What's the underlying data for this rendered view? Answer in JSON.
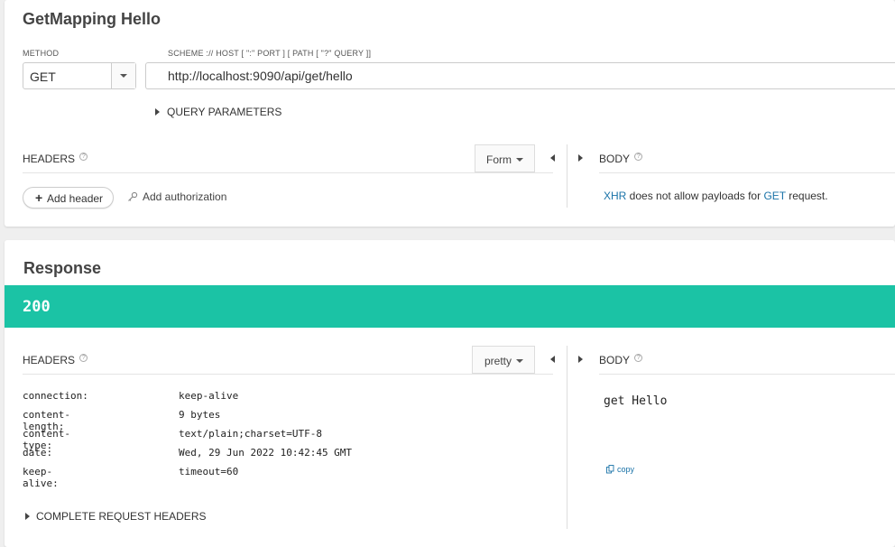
{
  "request": {
    "title": "GetMapping Hello",
    "method_label": "METHOD",
    "method_value": "GET",
    "url_label": "SCHEME :// HOST [ \":\" PORT ] [ PATH [ \"?\" QUERY ]]",
    "url_value": "http://localhost:9090/api/get/hello",
    "query_params_label": "QUERY PARAMETERS",
    "headers_label": "HEADERS",
    "form_button": "Form",
    "body_label": "BODY",
    "add_header": "Add header",
    "add_authorization": "Add authorization",
    "body_note_link1": "XHR",
    "body_note_middle": " does not allow payloads for ",
    "body_note_link2": "GET",
    "body_note_end": " request."
  },
  "response": {
    "title": "Response",
    "status_code": "200",
    "headers_label": "HEADERS",
    "pretty_button": "pretty",
    "body_label": "BODY",
    "headers": [
      {
        "name": "connection:",
        "value": "keep-alive"
      },
      {
        "name": "content-length:",
        "value": "9 bytes"
      },
      {
        "name": "content-type:",
        "value": "text/plain;charset=UTF-8"
      },
      {
        "name": "date:",
        "value": "Wed, 29 Jun 2022 10:42:45 GMT"
      },
      {
        "name": "keep-alive:",
        "value": "timeout=60"
      }
    ],
    "complete_request_headers": "COMPLETE REQUEST HEADERS",
    "body_text": "get Hello",
    "copy_label": "copy"
  },
  "colors": {
    "status_ok": "#1bc3a5",
    "link": "#1a73a8"
  },
  "icons": {
    "help": "help-circle-icon",
    "plus": "plus-icon",
    "key": "key-icon",
    "copy": "copy-icon"
  }
}
